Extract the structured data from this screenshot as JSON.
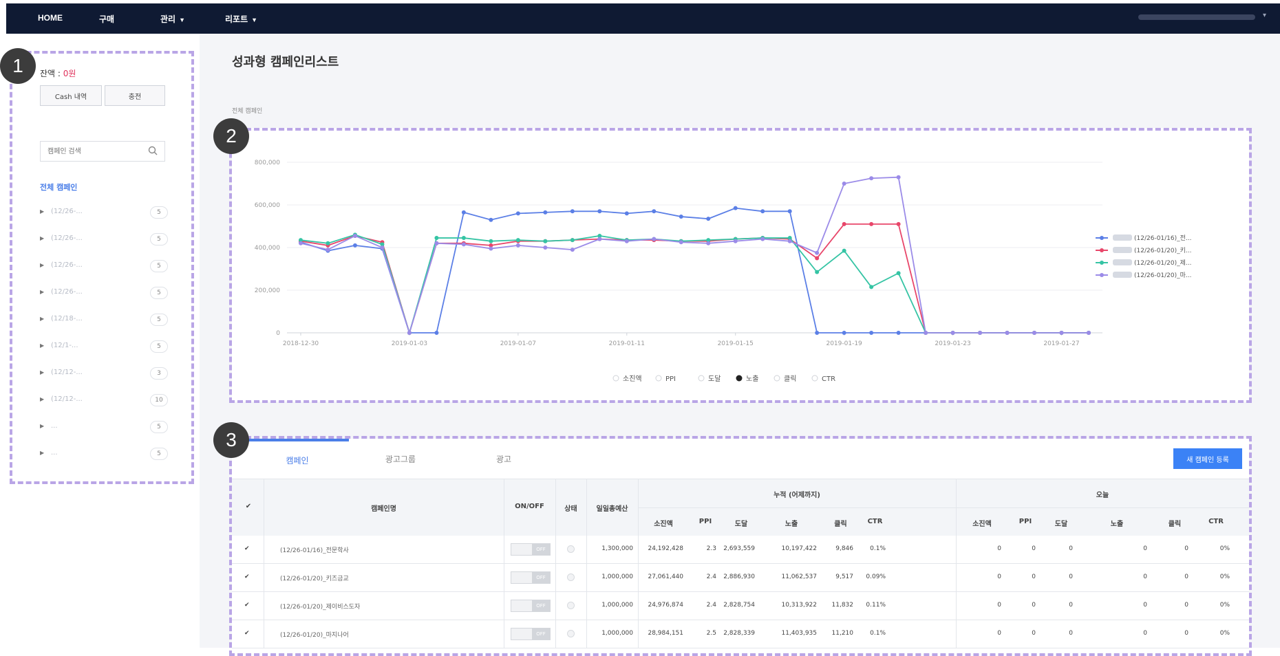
{
  "nav": {
    "items": [
      {
        "label": "HOME",
        "dropdown": false
      },
      {
        "label": "구매",
        "dropdown": false
      },
      {
        "label": "관리",
        "dropdown": true
      },
      {
        "label": "리포트",
        "dropdown": true
      }
    ]
  },
  "sidebar": {
    "balance_label": "잔액 : ",
    "balance_value": "0원",
    "cash_button": "Cash 내역",
    "charge_button": "충전",
    "search_placeholder": "캠페인 검색",
    "all_campaigns": "전체 캠페인",
    "campaigns": [
      {
        "name": "(12/26-...",
        "count": "5"
      },
      {
        "name": "(12/26-...",
        "count": "5"
      },
      {
        "name": "(12/26-...",
        "count": "5"
      },
      {
        "name": "(12/26-...",
        "count": "5"
      },
      {
        "name": "(12/18-...",
        "count": "5"
      },
      {
        "name": "(12/1-...",
        "count": "5"
      },
      {
        "name": "(12/12-...",
        "count": "3"
      },
      {
        "name": "(12/12-...",
        "count": "10"
      },
      {
        "name": "...",
        "count": "5"
      },
      {
        "name": "...",
        "count": "5"
      }
    ]
  },
  "main": {
    "title": "성과형 캠페인리스트",
    "breadcrumb": "전체 캠페인"
  },
  "markers": [
    "1",
    "2",
    "3"
  ],
  "chart_data": {
    "type": "line",
    "ylim": [
      0,
      800000
    ],
    "yticks": [
      "0",
      "200,000",
      "400,000",
      "600,000",
      "800,000"
    ],
    "x": [
      "2018-12-30",
      "2018-12-31",
      "2019-01-01",
      "2019-01-02",
      "2019-01-03",
      "2019-01-04",
      "2019-01-05",
      "2019-01-06",
      "2019-01-07",
      "2019-01-08",
      "2019-01-09",
      "2019-01-10",
      "2019-01-11",
      "2019-01-12",
      "2019-01-13",
      "2019-01-14",
      "2019-01-15",
      "2019-01-16",
      "2019-01-17",
      "2019-01-18",
      "2019-01-19",
      "2019-01-20",
      "2019-01-21",
      "2019-01-22",
      "2019-01-23",
      "2019-01-24",
      "2019-01-25",
      "2019-01-26",
      "2019-01-27",
      "2019-01-28"
    ],
    "xticks": [
      "2018-12-30",
      "2019-01-03",
      "2019-01-07",
      "2019-01-11",
      "2019-01-15",
      "2019-01-19",
      "2019-01-23",
      "2019-01-27"
    ],
    "series": [
      {
        "name": "(12/26-01/16)_전...",
        "color": "#5b7fe6",
        "values": [
          425000,
          385000,
          410000,
          395000,
          0,
          0,
          565000,
          530000,
          560000,
          565000,
          570000,
          570000,
          560000,
          570000,
          545000,
          535000,
          585000,
          570000,
          570000,
          0,
          0,
          0,
          0,
          0,
          0,
          0,
          0,
          0,
          0,
          0
        ]
      },
      {
        "name": "(12/26-01/20)_키...",
        "color": "#e8466a",
        "values": [
          430000,
          410000,
          455000,
          425000,
          0,
          420000,
          420000,
          410000,
          430000,
          430000,
          435000,
          440000,
          435000,
          435000,
          430000,
          430000,
          440000,
          445000,
          440000,
          350000,
          510000,
          510000,
          510000,
          0,
          0,
          0,
          0,
          0,
          0,
          0
        ]
      },
      {
        "name": "(12/26-01/20)_제...",
        "color": "#35c4a4",
        "values": [
          435000,
          420000,
          460000,
          415000,
          0,
          445000,
          445000,
          430000,
          435000,
          430000,
          435000,
          455000,
          435000,
          440000,
          430000,
          435000,
          440000,
          445000,
          445000,
          285000,
          385000,
          215000,
          280000,
          0,
          0,
          0,
          0,
          0,
          0,
          0
        ]
      },
      {
        "name": "(12/26-01/20)_마...",
        "color": "#9b8be8",
        "values": [
          420000,
          390000,
          455000,
          400000,
          0,
          420000,
          415000,
          395000,
          410000,
          400000,
          390000,
          440000,
          430000,
          440000,
          425000,
          420000,
          430000,
          440000,
          430000,
          375000,
          700000,
          725000,
          730000,
          0,
          0,
          0,
          0,
          0,
          0,
          0
        ]
      }
    ],
    "metric_options": [
      {
        "label": "소진액",
        "selected": false
      },
      {
        "label": "PPI",
        "selected": false
      },
      {
        "label": "도달",
        "selected": false
      },
      {
        "label": "노출",
        "selected": true
      },
      {
        "label": "클릭",
        "selected": false
      },
      {
        "label": "CTR",
        "selected": false
      }
    ]
  },
  "table": {
    "tabs": [
      "캠페인",
      "광고그룹",
      "광고"
    ],
    "active_tab": 0,
    "new_button": "새 캠페인 등록",
    "headers": {
      "name": "캠페인명",
      "onoff": "ON/OFF",
      "status": "상태",
      "budget": "일일총예산",
      "cumulative": "누적 (어제까지)",
      "today": "오늘",
      "metrics": [
        "소진액",
        "PPI",
        "도달",
        "노출",
        "클릭",
        "CTR"
      ]
    },
    "rows": [
      {
        "name": "(12/26-01/16)_전문학사",
        "budget": "1,300,000",
        "cum": [
          "24,192,428",
          "2.3",
          "2,693,559",
          "10,197,422",
          "9,846",
          "0.1%"
        ],
        "today": [
          "0",
          "0",
          "0",
          "0",
          "0",
          "0%"
        ]
      },
      {
        "name": "(12/26-01/20)_키즈금교",
        "budget": "1,000,000",
        "cum": [
          "27,061,440",
          "2.4",
          "2,886,930",
          "11,062,537",
          "9,517",
          "0.09%"
        ],
        "today": [
          "0",
          "0",
          "0",
          "0",
          "0",
          "0%"
        ]
      },
      {
        "name": "(12/26-01/20)_제이비스도자",
        "budget": "1,000,000",
        "cum": [
          "24,976,874",
          "2.4",
          "2,828,754",
          "10,313,922",
          "11,832",
          "0.11%"
        ],
        "today": [
          "0",
          "0",
          "0",
          "0",
          "0",
          "0%"
        ]
      },
      {
        "name": "(12/26-01/20)_마지나어",
        "budget": "1,000,000",
        "cum": [
          "28,984,151",
          "2.5",
          "2,828,339",
          "11,403,935",
          "11,210",
          "0.1%"
        ],
        "today": [
          "0",
          "0",
          "0",
          "0",
          "0",
          "0%"
        ]
      }
    ]
  }
}
